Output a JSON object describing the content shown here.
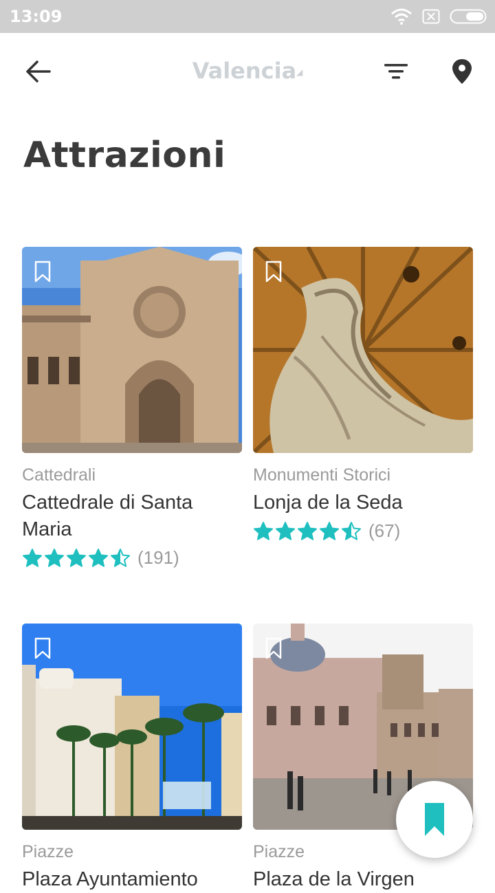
{
  "status_bar": {
    "time": "13:09"
  },
  "header": {
    "city": "Valencia"
  },
  "page_title": "Attrazioni",
  "attractions": [
    {
      "category": "Cattedrali",
      "name": "Cattedrale di Santa Maria",
      "rating": 4.5,
      "reviews": "(191)"
    },
    {
      "category": "Monumenti Storici",
      "name": "Lonja de la Seda",
      "rating": 4.5,
      "reviews": "(67)"
    },
    {
      "category": "Piazze",
      "name": "Plaza Ayuntamiento"
    },
    {
      "category": "Piazze",
      "name": "Plaza de la Virgen"
    }
  ],
  "colors": {
    "accent": "#1fbfbf",
    "muted": "#9a9a9a",
    "title": "#3b3b3b"
  },
  "icons": {
    "back": "arrow-left-icon",
    "filter": "filter-icon",
    "map": "map-pin-icon",
    "save": "bookmark-icon"
  }
}
